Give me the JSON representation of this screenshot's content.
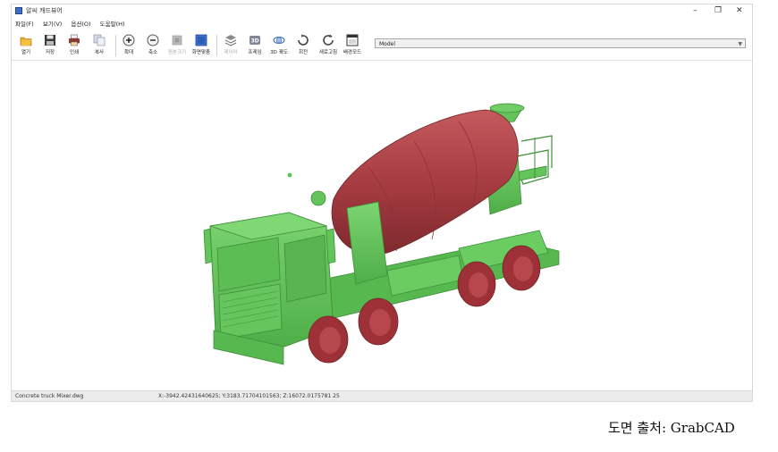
{
  "window": {
    "title": "알씨 캐드뷰어",
    "controls": {
      "minimize": "–",
      "restore": "❐",
      "close": "✕"
    }
  },
  "menu": {
    "items": [
      "파일(F)",
      "보기(V)",
      "옵션(O)",
      "도움말(H)"
    ]
  },
  "toolbar": {
    "buttons": [
      {
        "label": "열기",
        "icon": "folder-open-icon",
        "enabled": true
      },
      {
        "label": "저장",
        "icon": "floppy-save-icon",
        "enabled": true
      },
      {
        "label": "인쇄",
        "icon": "printer-icon",
        "enabled": true
      },
      {
        "label": "복사",
        "icon": "copy-icon",
        "enabled": true
      },
      {
        "label": "확대",
        "icon": "zoom-in-icon",
        "enabled": true
      },
      {
        "label": "축소",
        "icon": "zoom-out-icon",
        "enabled": true
      },
      {
        "label": "원본크기",
        "icon": "original-size-icon",
        "enabled": false
      },
      {
        "label": "화면맞춤",
        "icon": "fit-screen-icon",
        "enabled": true
      },
      {
        "label": "레이어",
        "icon": "layers-icon",
        "enabled": false
      },
      {
        "label": "프레임",
        "icon": "3d-frame-icon",
        "enabled": true
      },
      {
        "label": "3D 궤도",
        "icon": "3d-orbit-icon",
        "enabled": true
      },
      {
        "label": "회전",
        "icon": "rotate-icon",
        "enabled": true
      },
      {
        "label": "새로고침",
        "icon": "refresh-icon",
        "enabled": true
      },
      {
        "label": "배경모드",
        "icon": "background-mode-icon",
        "enabled": true
      }
    ],
    "model_select": {
      "value": "Model"
    }
  },
  "status": {
    "file": "Concrete truck Mixer.dwg",
    "coords": "X:-3942.42431640625; Y:3183.71704101563; Z:16072.0175781 25"
  },
  "caption": "도면 출처: GrabCAD",
  "colors": {
    "truck_body": "#62c45a",
    "truck_dark": "#3f8f3a",
    "drum": "#a33a3f",
    "drum_light": "#c45a5e",
    "wheel": "#9e3138",
    "accent_blue": "#3c6fc9"
  }
}
